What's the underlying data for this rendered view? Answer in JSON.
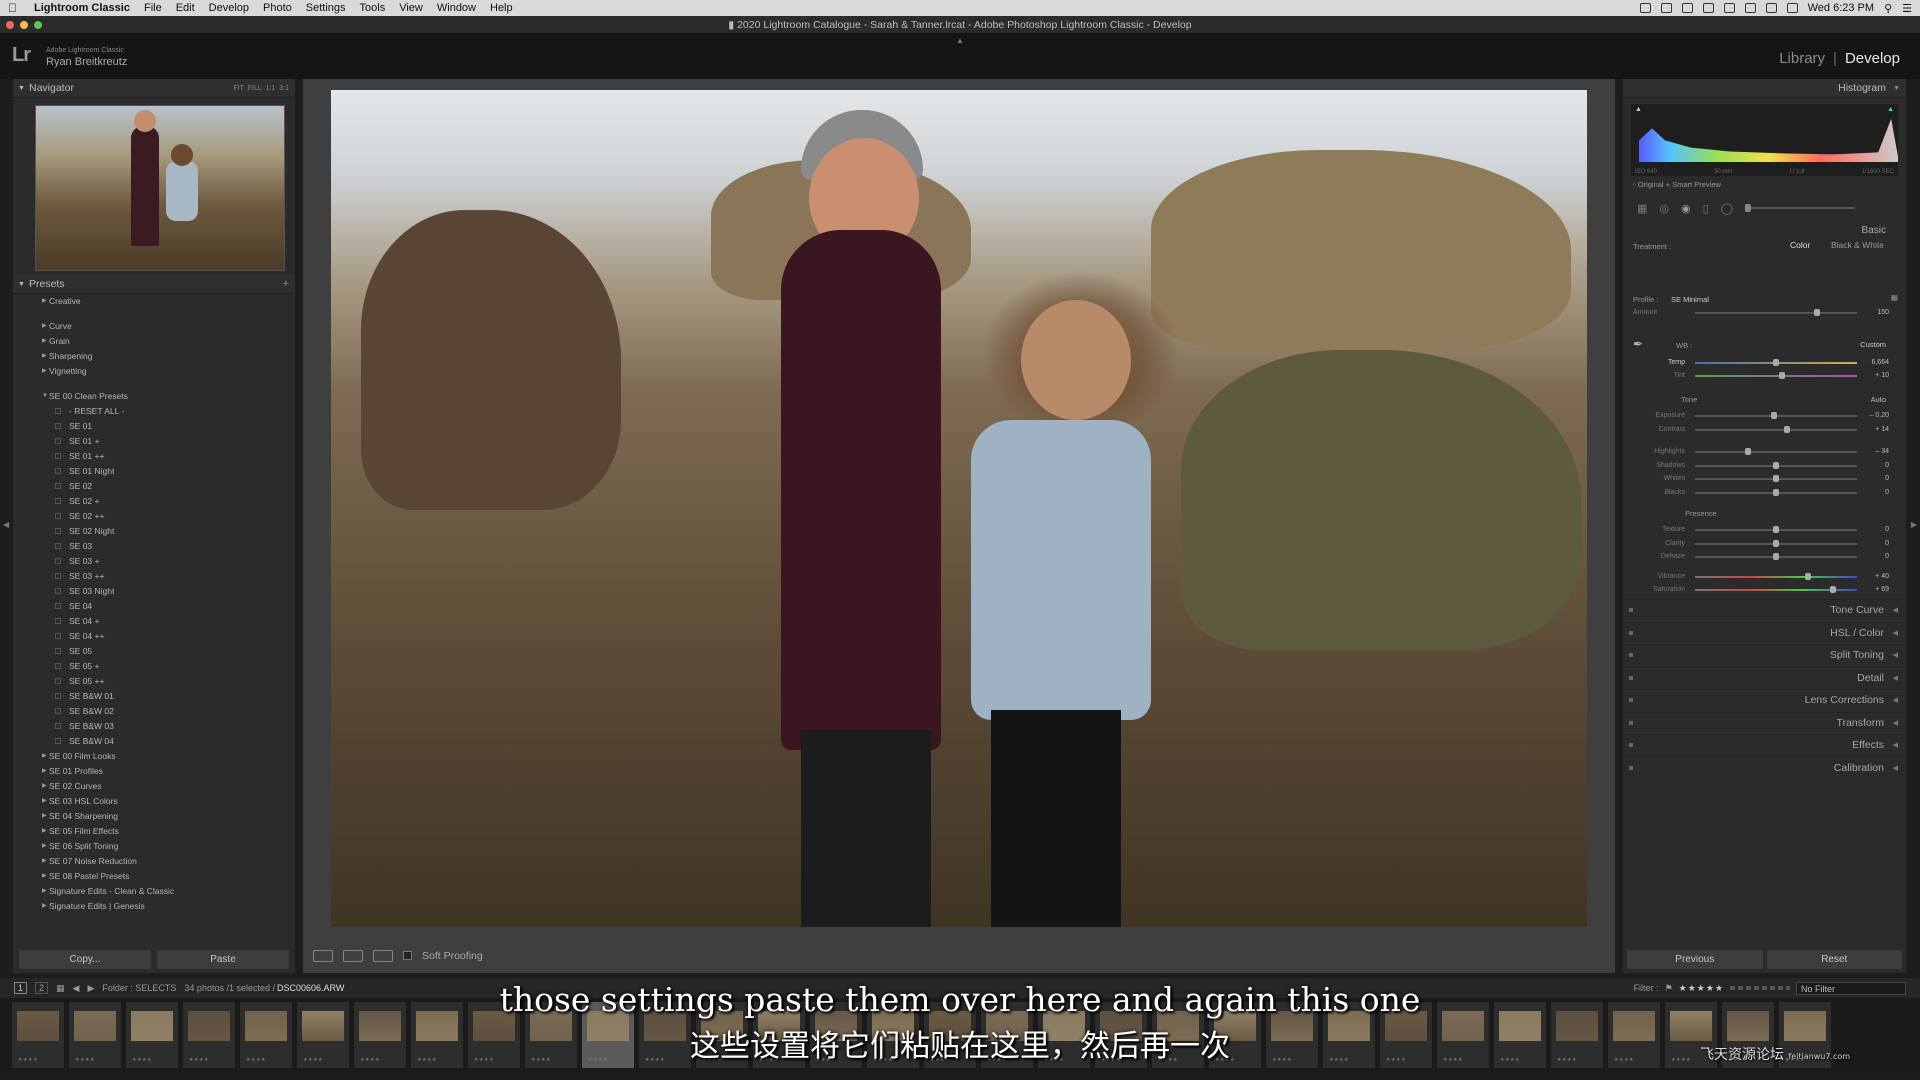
{
  "menubar": {
    "app_name": "Lightroom Classic",
    "items": [
      "File",
      "Edit",
      "Develop",
      "Photo",
      "Settings",
      "Tools",
      "View",
      "Window",
      "Help"
    ],
    "clock": "Wed 6:23 PM"
  },
  "window": {
    "title": "2020 Lightroom Catalogue - Sarah & Tanner.lrcat - Adobe Photoshop Lightroom Classic - Develop"
  },
  "identity": {
    "logo": "Lr",
    "product": "Adobe Lightroom Classic",
    "user": "Ryan Breitkreutz",
    "modules": [
      "Library",
      "Develop"
    ],
    "active_module": "Develop"
  },
  "left_panel": {
    "navigator_title": "Navigator",
    "navigator_zoom": [
      "FIT",
      "FILL",
      "1:1",
      "3:1"
    ],
    "presets_title": "Presets",
    "presets_add": "+",
    "groups_top": [
      "Creative"
    ],
    "groups_mid": [
      "Curve",
      "Grain",
      "Sharpening",
      "Vignetting"
    ],
    "open_group": "SE 00 Clean Presets",
    "open_group_children": [
      "- RESET ALL -",
      "SE 01",
      "SE 01 +",
      "SE 01 ++",
      "SE 01 Night",
      "SE 02",
      "SE 02 +",
      "SE 02 ++",
      "SE 02 Night",
      "SE 03",
      "SE 03 +",
      "SE 03 ++",
      "SE 03 Night",
      "SE 04",
      "SE 04 +",
      "SE 04 ++",
      "SE 05",
      "SE 05 +",
      "SE 05 ++",
      "SE B&W 01",
      "SE B&W 02",
      "SE B&W 03",
      "SE B&W 04"
    ],
    "groups_bottom": [
      "SE 00 Film Looks",
      "SE 01 Profiles",
      "SE 02 Curves",
      "SE 03 HSL Colors",
      "SE 04 Sharpening",
      "SE 05 Film Effects",
      "SE 06 Split Toning",
      "SE 07 Noise Reduction",
      "SE 08 Pastel Presets",
      "Signature Edits - Clean & Classic",
      "Signature Edits | Genesis"
    ],
    "copy_label": "Copy...",
    "paste_label": "Paste"
  },
  "toolbar": {
    "soft_proofing_label": "Soft Proofing"
  },
  "right_panel": {
    "histogram_title": "Histogram",
    "histogram_info": [
      "ISO 640",
      "50 mm",
      "f / 1.8",
      "1/1600 SEC"
    ],
    "preview_label": "Original + Smart Preview",
    "basic_title": "Basic",
    "treatment_label": "Treatment :",
    "treatment_options": [
      "Color",
      "Black & White"
    ],
    "profile_label": "Profile :",
    "profile_value": "SE Minimal",
    "amount_label": "Amount",
    "amount_value": "150",
    "amount_level": 0.75,
    "wb_label": "WB :",
    "wb_value": "Custom",
    "temp_label": "Temp",
    "temp_value": "6,664",
    "temp_level": 0.5,
    "tint_label": "Tint",
    "tint_value": "+ 10",
    "tint_level": 0.54,
    "tone_label": "Tone",
    "auto_label": "Auto",
    "tone_sliders": [
      {
        "label": "Exposure",
        "value": "– 0.20",
        "level": 0.49
      },
      {
        "label": "Contrast",
        "value": "+ 14",
        "level": 0.57
      },
      {
        "label": "Highlights",
        "value": "– 34",
        "level": 0.33
      },
      {
        "label": "Shadows",
        "value": "0",
        "level": 0.5
      },
      {
        "label": "Whites",
        "value": "0",
        "level": 0.5
      },
      {
        "label": "Blacks",
        "value": "0",
        "level": 0.5
      }
    ],
    "presence_label": "Presence",
    "presence_sliders": [
      {
        "label": "Texture",
        "value": "0",
        "level": 0.5
      },
      {
        "label": "Clarity",
        "value": "0",
        "level": 0.5
      },
      {
        "label": "Dehaze",
        "value": "0",
        "level": 0.5
      },
      {
        "label": "Vibrance",
        "value": "+ 40",
        "level": 0.7
      },
      {
        "label": "Saturation",
        "value": "+ 69",
        "level": 0.85
      }
    ],
    "sections": [
      "Tone Curve",
      "HSL / Color",
      "Split Toning",
      "Detail",
      "Lens Corrections",
      "Transform",
      "Effects",
      "Calibration"
    ],
    "previous_label": "Previous",
    "reset_label": "Reset"
  },
  "filmstrip": {
    "pages": [
      "1",
      "2"
    ],
    "folder_label": "Folder : SELECTS",
    "count_label": "34 photos /1 selected /",
    "filename": "DSC00606.ARW",
    "filter_label": "Filter :",
    "stars": "★★★★★",
    "filter_value": "No Filter",
    "thumb_count": 32
  },
  "subtitles": {
    "english": "those settings paste them over here and again this one",
    "chinese": "这些设置将它们粘贴在这里，然后再一次"
  },
  "watermark": {
    "main": "飞天资源论坛",
    "url": "feitianwu7.com"
  }
}
